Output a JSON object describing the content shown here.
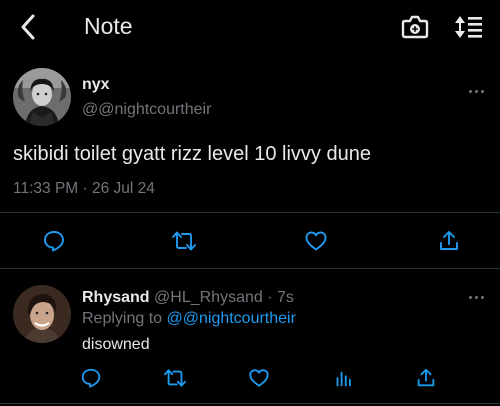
{
  "header": {
    "title": "Note",
    "back_icon": "chevron-left-icon",
    "camera_icon": "camera-plus-icon",
    "sort_icon": "sort-list-icon"
  },
  "tweet": {
    "author_name": "nyx",
    "author_handle": "@@nightcourtheir",
    "text": "skibidi toilet gyatt rizz level 10 livvy dune",
    "timestamp": "11:33 PM · 26 Jul 24",
    "actions": [
      "reply-icon",
      "retweet-icon",
      "like-icon",
      "share-icon"
    ]
  },
  "reply": {
    "author_name": "Rhysand",
    "author_handle": "@HL_Rhysand",
    "time": "· 7s",
    "replying_prefix": "Replying to",
    "replying_handle": "@@nightcourtheir",
    "text": "disowned",
    "actions": [
      "reply-icon",
      "retweet-icon",
      "like-icon",
      "analytics-icon",
      "share-icon"
    ]
  },
  "colors": {
    "background": "#000000",
    "text": "#e7e9ea",
    "secondary": "#71767b",
    "accent": "#1d9bf0",
    "divider": "#2f3336"
  }
}
